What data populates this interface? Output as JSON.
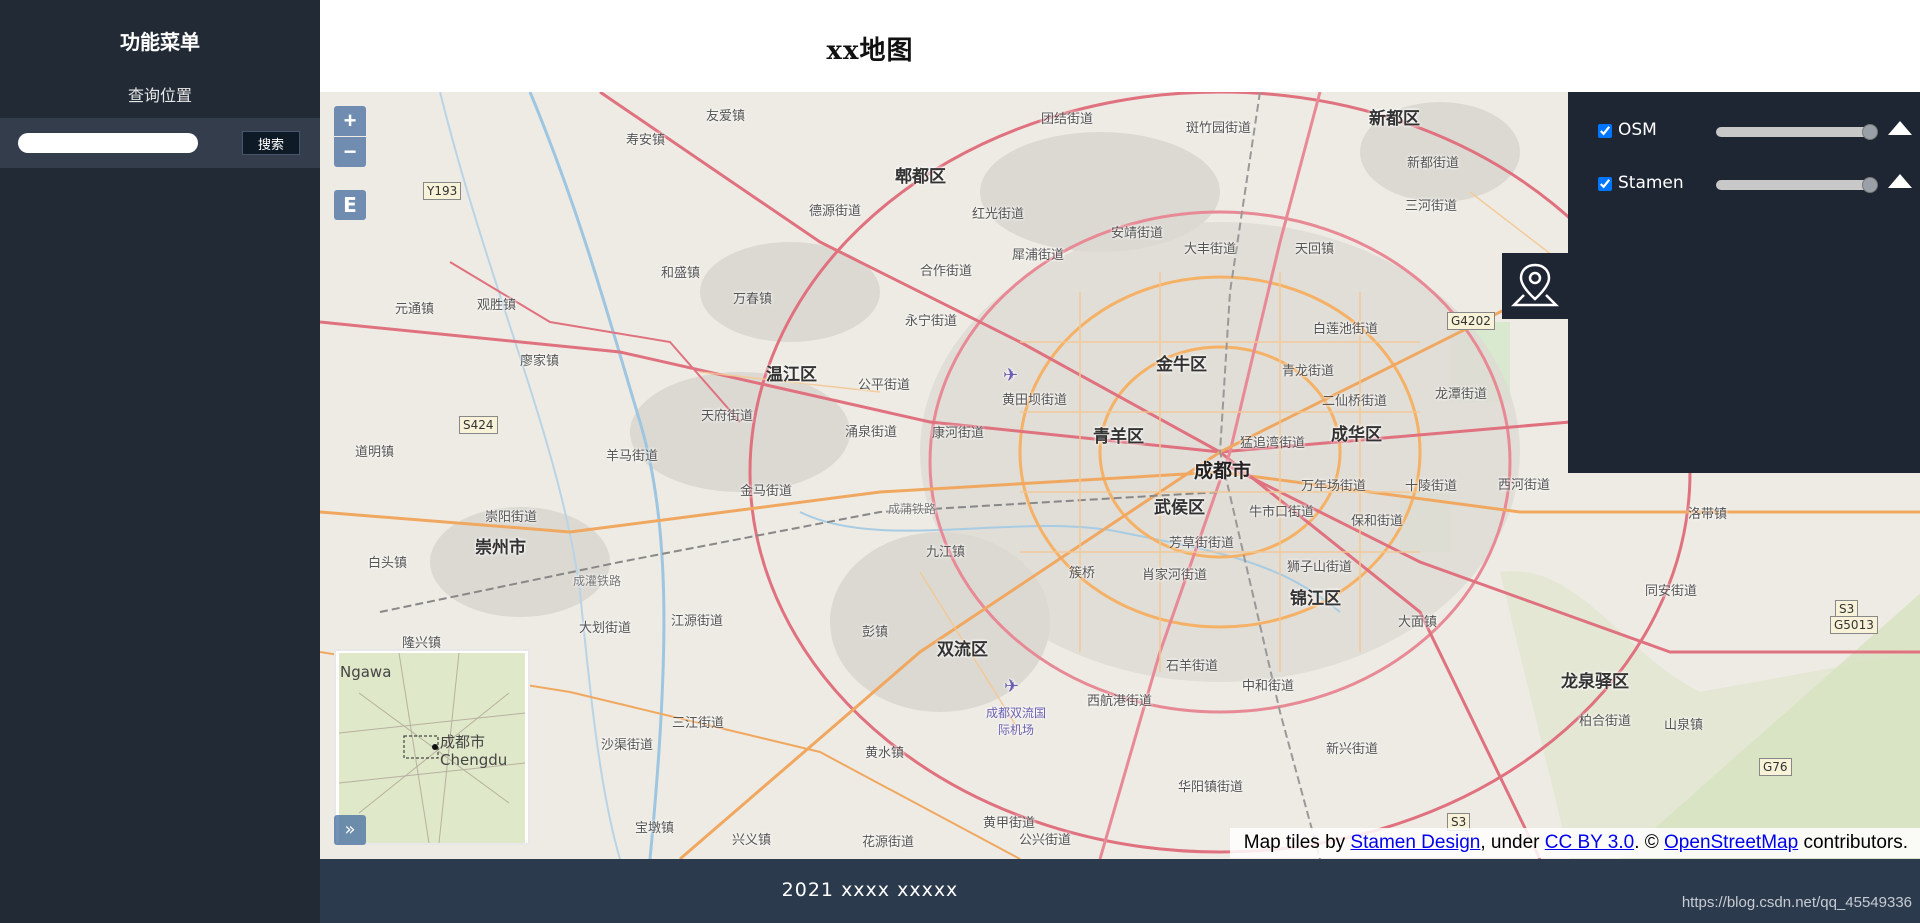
{
  "sidebar": {
    "title": "功能菜单",
    "subtitle": "查询位置",
    "search_placeholder": "",
    "search_button": "搜索"
  },
  "header": {
    "title": "xx地图"
  },
  "map": {
    "zoom_in": "+",
    "zoom_out": "−",
    "extent_button": "E",
    "overview_toggle": "»",
    "layers": [
      {
        "name": "OSM",
        "checked": true,
        "opacity": 1.0
      },
      {
        "name": "Stamen",
        "checked": true,
        "opacity": 1.0
      }
    ],
    "places": [
      {
        "text": "友爱镇"
      },
      {
        "text": "寿安镇"
      },
      {
        "text": "郫都区"
      },
      {
        "text": "团结街道"
      },
      {
        "text": "斑竹园街道"
      },
      {
        "text": "新都区"
      },
      {
        "text": "新都街道"
      },
      {
        "text": "三河街道"
      },
      {
        "text": "德源街道"
      },
      {
        "text": "红光街道"
      },
      {
        "text": "安靖街道"
      },
      {
        "text": "大丰街道"
      },
      {
        "text": "天回镇"
      },
      {
        "text": "和盛镇"
      },
      {
        "text": "合作街道"
      },
      {
        "text": "犀浦街道"
      },
      {
        "text": "元通镇"
      },
      {
        "text": "观胜镇"
      },
      {
        "text": "万春镇"
      },
      {
        "text": "永宁街道"
      },
      {
        "text": "白莲池街道"
      },
      {
        "text": "廖家镇"
      },
      {
        "text": "温江区"
      },
      {
        "text": "金牛区"
      },
      {
        "text": "青龙街道"
      },
      {
        "text": "公平街道"
      },
      {
        "text": "黄田坝街道"
      },
      {
        "text": "二仙桥街道"
      },
      {
        "text": "龙潭街道"
      },
      {
        "text": "天府街道"
      },
      {
        "text": "涌泉街道"
      },
      {
        "text": "康河街道"
      },
      {
        "text": "青羊区"
      },
      {
        "text": "猛追湾街道"
      },
      {
        "text": "成华区"
      },
      {
        "text": "道明镇"
      },
      {
        "text": "羊马街道"
      },
      {
        "text": "成都市"
      },
      {
        "text": "万年场街道"
      },
      {
        "text": "十陵街道"
      },
      {
        "text": "西河街道"
      },
      {
        "text": "金马街道"
      },
      {
        "text": "武侯区"
      },
      {
        "text": "牛市口街道"
      },
      {
        "text": "保和街道"
      },
      {
        "text": "洛带镇"
      },
      {
        "text": "崇州市"
      },
      {
        "text": "崇阳街道"
      },
      {
        "text": "九江镇"
      },
      {
        "text": "芳草街街道"
      },
      {
        "text": "狮子山街道"
      },
      {
        "text": "白头镇"
      },
      {
        "text": "簇桥"
      },
      {
        "text": "肖家河街道"
      },
      {
        "text": "锦江区"
      },
      {
        "text": "同安街道"
      },
      {
        "text": "大划街道"
      },
      {
        "text": "江源街道"
      },
      {
        "text": "彭镇"
      },
      {
        "text": "双流区"
      },
      {
        "text": "石羊街道"
      },
      {
        "text": "大面镇"
      },
      {
        "text": "龙泉驿区"
      },
      {
        "text": "隆兴镇"
      },
      {
        "text": "中和街道"
      },
      {
        "text": "西航港街道"
      },
      {
        "text": "三江街道"
      },
      {
        "text": "成都双流国际机场"
      },
      {
        "text": "柏合街道"
      },
      {
        "text": "山泉镇"
      },
      {
        "text": "沙渠街道"
      },
      {
        "text": "黄水镇"
      },
      {
        "text": "新兴街道"
      },
      {
        "text": "华阳镇街道"
      },
      {
        "text": "宝墩镇"
      },
      {
        "text": "黄甲街道"
      },
      {
        "text": "兴义镇"
      },
      {
        "text": "花源街道"
      },
      {
        "text": "公兴街道"
      },
      {
        "text": "成蒲铁路"
      },
      {
        "text": "成灌铁路"
      }
    ],
    "shields": [
      "Y193",
      "S424",
      "G4202",
      "S3",
      "G5013",
      "G76",
      "S3"
    ],
    "overview_labels": [
      "Ngawa",
      "成都市",
      "Chengdu"
    ],
    "attribution": {
      "prefix": "Map tiles by ",
      "stamen": "Stamen Design",
      "mid1": ", under ",
      "cc": "CC BY 3.0",
      "mid2": ". © ",
      "osm": "OpenStreetMap",
      "suffix": " contributors."
    }
  },
  "footer": {
    "text": "2021  xxxx  xxxxx"
  },
  "watermark": "https://blog.csdn.net/qq_45549336",
  "colors": {
    "sidebar_bg": "#222a36",
    "panel_bg": "#1f2633",
    "footer_bg": "#2b3a4c",
    "control_blue": "#466ea0"
  }
}
